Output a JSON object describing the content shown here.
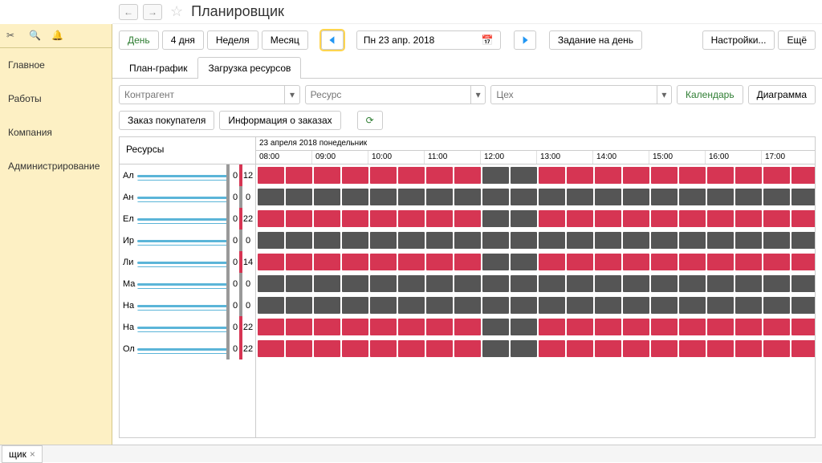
{
  "sidebar": {
    "items": [
      "Главное",
      "Работы",
      "Компания",
      "Администрирование"
    ]
  },
  "header": {
    "title": "Планировщик"
  },
  "toolbar": {
    "day": "День",
    "days4": "4 дня",
    "week": "Неделя",
    "month": "Месяц",
    "date": "Пн 23 апр. 2018",
    "task_for_day": "Задание на день",
    "settings": "Настройки...",
    "more": "Ещё"
  },
  "tabs": {
    "plan": "План-график",
    "load": "Загрузка ресурсов"
  },
  "filters": {
    "counterparty": "Контрагент",
    "resource": "Ресурс",
    "workshop": "Цех",
    "calendar": "Календарь",
    "diagram": "Диаграмма"
  },
  "actions": {
    "order": "Заказ покупателя",
    "info": "Информация о заказах"
  },
  "gantt": {
    "resources_label": "Ресурсы",
    "date_header": "23 апреля 2018 понедельник",
    "hours": [
      "08:00",
      "09:00",
      "10:00",
      "11:00",
      "12:00",
      "13:00",
      "14:00",
      "15:00",
      "16:00",
      "17:00"
    ],
    "rows": [
      {
        "name": "Ал",
        "c1": 0,
        "c2": 12,
        "busy": [
          1,
          1,
          1,
          1,
          1,
          1,
          1,
          1,
          0,
          0,
          1,
          1,
          1,
          1,
          1,
          1,
          1,
          1,
          1,
          1
        ]
      },
      {
        "name": "Ан",
        "c1": 0,
        "c2": 0,
        "busy": [
          0,
          0,
          0,
          0,
          0,
          0,
          0,
          0,
          0,
          0,
          0,
          0,
          0,
          0,
          0,
          0,
          0,
          0,
          0,
          0
        ]
      },
      {
        "name": "Ел",
        "c1": 0,
        "c2": 22,
        "busy": [
          1,
          1,
          1,
          1,
          1,
          1,
          1,
          1,
          0,
          0,
          1,
          1,
          1,
          1,
          1,
          1,
          1,
          1,
          1,
          1
        ]
      },
      {
        "name": "Ир",
        "c1": 0,
        "c2": 0,
        "busy": [
          0,
          0,
          0,
          0,
          0,
          0,
          0,
          0,
          0,
          0,
          0,
          0,
          0,
          0,
          0,
          0,
          0,
          0,
          0,
          0
        ]
      },
      {
        "name": "Ли",
        "c1": 0,
        "c2": 14,
        "busy": [
          1,
          1,
          1,
          1,
          1,
          1,
          1,
          1,
          0,
          0,
          1,
          1,
          1,
          1,
          1,
          1,
          1,
          1,
          1,
          1
        ]
      },
      {
        "name": "Ма",
        "c1": 0,
        "c2": 0,
        "busy": [
          0,
          0,
          0,
          0,
          0,
          0,
          0,
          0,
          0,
          0,
          0,
          0,
          0,
          0,
          0,
          0,
          0,
          0,
          0,
          0
        ]
      },
      {
        "name": "На",
        "c1": 0,
        "c2": 0,
        "busy": [
          0,
          0,
          0,
          0,
          0,
          0,
          0,
          0,
          0,
          0,
          0,
          0,
          0,
          0,
          0,
          0,
          0,
          0,
          0,
          0
        ]
      },
      {
        "name": "На",
        "c1": 0,
        "c2": 22,
        "busy": [
          1,
          1,
          1,
          1,
          1,
          1,
          1,
          1,
          0,
          0,
          1,
          1,
          1,
          1,
          1,
          1,
          1,
          1,
          1,
          1
        ]
      },
      {
        "name": "Ол",
        "c1": 0,
        "c2": 22,
        "busy": [
          1,
          1,
          1,
          1,
          1,
          1,
          1,
          1,
          0,
          0,
          1,
          1,
          1,
          1,
          1,
          1,
          1,
          1,
          1,
          1
        ]
      }
    ]
  },
  "bottom_tab": "щик"
}
